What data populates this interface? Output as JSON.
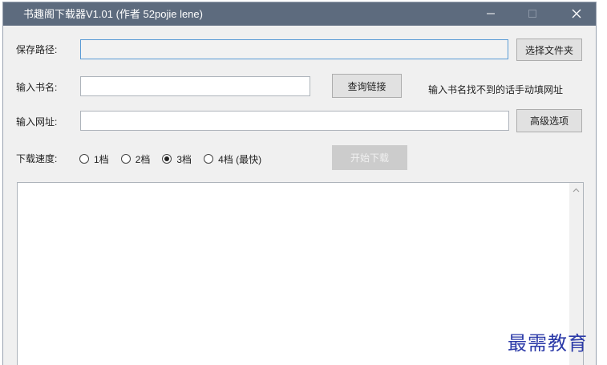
{
  "window": {
    "title": "书趣阁下载器V1.01 (作者 52pojie lene)"
  },
  "titlebar_controls": {
    "minimize_glyph": "—",
    "maximize_glyph": "☐",
    "close_glyph": "✕"
  },
  "save_path": {
    "label": "保存路径:",
    "value": "",
    "browse_label": "选择文件夹"
  },
  "book_name": {
    "label": "输入书名:",
    "value": "",
    "query_label": "查询链接",
    "hint": "输入书名找不到的话手动填网址"
  },
  "url": {
    "label": "输入网址:",
    "value": "",
    "advanced_label": "高级选项"
  },
  "speed": {
    "label": "下载速度:",
    "options": [
      "1档",
      "2档",
      "3档",
      "4档 (最快)"
    ],
    "selected": "3档"
  },
  "start_button": {
    "label": "开始下载",
    "enabled": false
  },
  "log": {
    "text": ""
  },
  "watermark": {
    "text": "最需教育"
  },
  "colors": {
    "titlebar": "#5d6b7e",
    "window_bg": "#f0f0f0",
    "focus_border": "#5a9bd5",
    "watermark": "#2b3aa8"
  }
}
